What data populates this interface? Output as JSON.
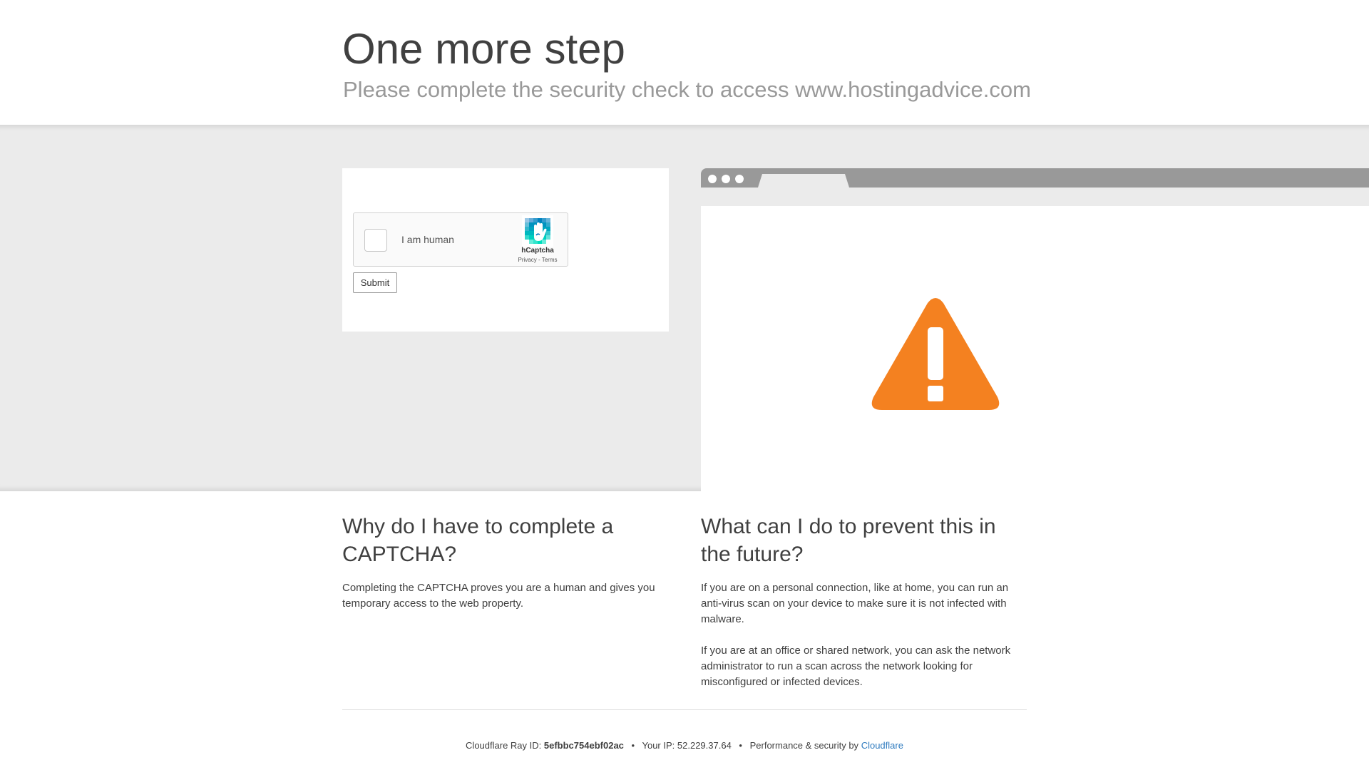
{
  "header": {
    "title": "One more step",
    "subtitle": "Please complete the security check to access www.hostingadvice.com"
  },
  "captcha": {
    "checkbox_label": "I am human",
    "brand": "hCaptcha",
    "privacy_link": "Privacy",
    "links_separator": " - ",
    "terms_link": "Terms",
    "submit_label": "Submit"
  },
  "illustration": {
    "icon": "warning-triangle-icon",
    "warning_color": "#f48120"
  },
  "info": {
    "why": {
      "heading": "Why do I have to complete a CAPTCHA?",
      "paragraphs": [
        "Completing the CAPTCHA proves you are a human and gives you temporary access to the web property."
      ]
    },
    "prevent": {
      "heading": "What can I do to prevent this in the future?",
      "paragraphs": [
        "If you are on a personal connection, like at home, you can run an anti-virus scan on your device to make sure it is not infected with malware.",
        "If you are at an office or shared network, you can ask the network administrator to run a scan across the network looking for misconfigured or infected devices."
      ]
    }
  },
  "footer": {
    "ray_label": "Cloudflare Ray ID:",
    "ray_id": "5efbbc754ebf02ac",
    "bullet": "•",
    "ip_label": "Your IP:",
    "ip": "52.229.37.64",
    "perf_label": "Performance & security by",
    "cloudflare_link": "Cloudflare",
    "link_color": "#2f7bbf"
  }
}
